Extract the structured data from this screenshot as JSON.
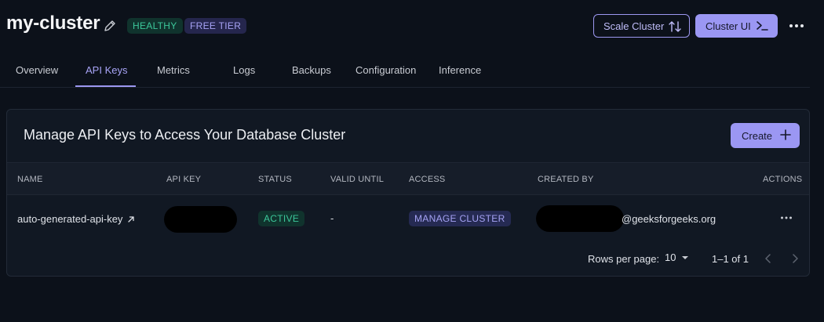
{
  "header": {
    "cluster_name": "my-cluster",
    "badges": {
      "health": "HEALTHY",
      "tier": "FREE TIER"
    },
    "scale_button_label": "Scale Cluster",
    "cluster_ui_button_label": "Cluster UI"
  },
  "tabs": [
    {
      "label": "Overview"
    },
    {
      "label": "API Keys",
      "active": true
    },
    {
      "label": "Metrics"
    },
    {
      "label": "Logs"
    },
    {
      "label": "Backups"
    },
    {
      "label": "Configuration"
    },
    {
      "label": "Inference"
    }
  ],
  "card": {
    "title": "Manage API Keys to Access Your Database Cluster",
    "create_label": "Create",
    "columns": [
      "NAME",
      "API KEY",
      "STATUS",
      "VALID UNTIL",
      "ACCESS",
      "CREATED BY",
      "ACTIONS"
    ],
    "rows": [
      {
        "name": "auto-generated-api-key",
        "status": "ACTIVE",
        "valid_until": "-",
        "access": "MANAGE CLUSTER",
        "created_by_visible": "@geeksforgeeks.org"
      }
    ],
    "pagination": {
      "rows_per_page_label": "Rows per page:",
      "rows_per_page_value": "10",
      "range": "1–1 of 1"
    }
  },
  "colors": {
    "background": "#0c111a",
    "accent": "#9b97f3",
    "healthy_green": "#3cc79a",
    "tier_purple": "#a6a3f5"
  }
}
